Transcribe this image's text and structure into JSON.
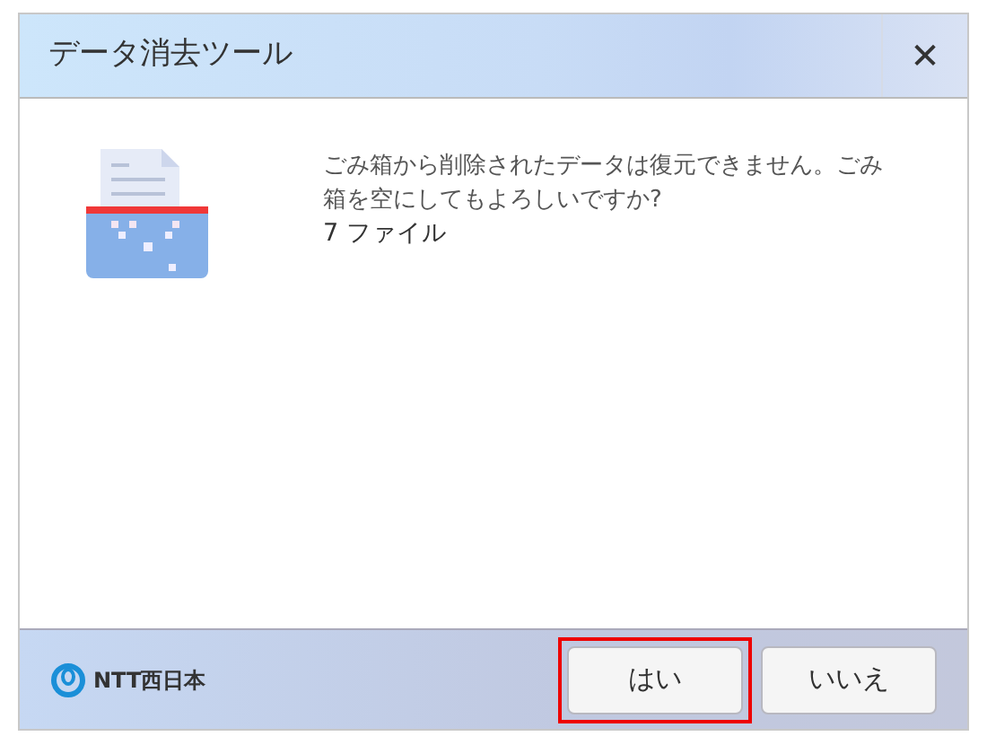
{
  "window": {
    "title": "データ消去ツール",
    "close": "✕"
  },
  "message": {
    "lines": [
      "ごみ箱から削除されたデータは復元できません。ごみ箱を空にしてもよろしいですか?"
    ],
    "count": "7 ファイル"
  },
  "footer": {
    "logo": "NTT西日本"
  },
  "buttons": [
    {
      "label": "はい",
      "highlighted": true
    },
    {
      "label": "いいえ",
      "highlighted": false
    }
  ]
}
